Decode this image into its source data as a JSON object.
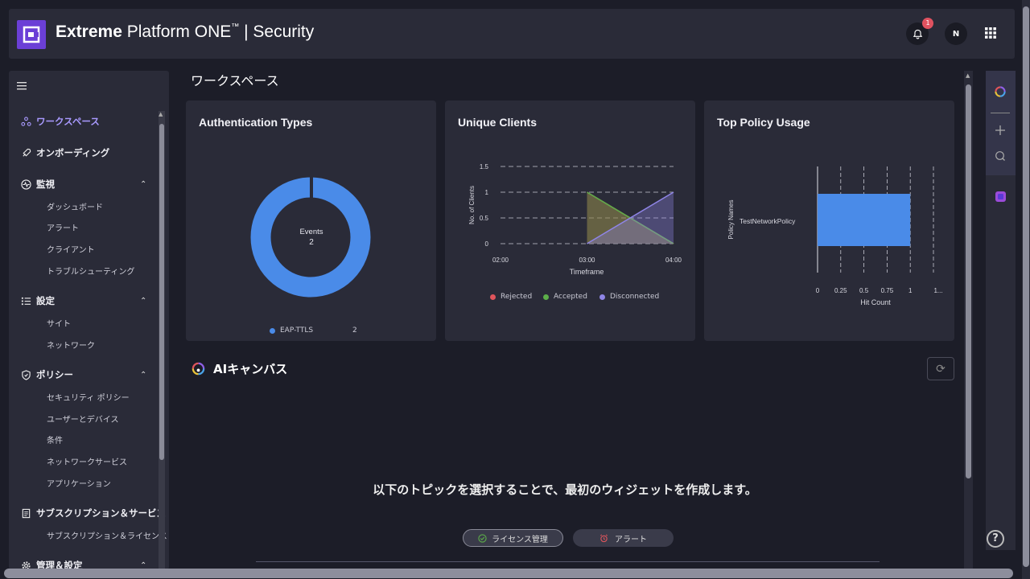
{
  "header": {
    "brand_bold": "Extreme",
    "brand_rest": " Platform ONE",
    "brand_sep": " | Security",
    "notifications_count": "1",
    "avatar_initial": "N"
  },
  "sidebar": {
    "sections": [
      {
        "label": "ワークスペース",
        "active": true,
        "items": []
      },
      {
        "label": "オンボーディング",
        "items": []
      },
      {
        "label": "監視",
        "items": [
          "ダッシュボード",
          "アラート",
          "クライアント",
          "トラブルシューティング"
        ]
      },
      {
        "label": "設定",
        "items": [
          "サイト",
          "ネットワーク"
        ]
      },
      {
        "label": "ポリシー",
        "items": [
          "セキュリティ ポリシー",
          "ユーザーとデバイス",
          "条件",
          "ネットワークサービス",
          "アプリケーション"
        ]
      },
      {
        "label": "サブスクリプション＆サービス",
        "items": [
          "サブスクリプション＆ライセンス"
        ]
      },
      {
        "label": "管理＆設定",
        "items": []
      }
    ]
  },
  "main": {
    "title": "ワークスペース",
    "ai_title": "AIキャンバス",
    "empty_message": "以下のトピックを選択することで、最初のウィジェットを作成します。",
    "pills": [
      "ライセンス管理",
      "アラート"
    ]
  },
  "colors": {
    "accent": "#6b3fd6",
    "blue": "#4a8be8",
    "rejected": "#e0555c",
    "accepted": "#5cae49",
    "disconnected": "#8f85e6"
  },
  "chart_data": [
    {
      "type": "pie",
      "title": "Authentication Types",
      "center_label": "Events",
      "center_value": "2",
      "categories": [
        "EAP-TTLS"
      ],
      "values": [
        2
      ]
    },
    {
      "type": "area",
      "title": "Unique Clients",
      "xlabel": "Timeframe",
      "ylabel": "No. of Clients",
      "x": [
        "02:00",
        "03:00",
        "04:00"
      ],
      "y_ticks": [
        "0",
        "0.5",
        "1",
        "1.5"
      ],
      "ylim": [
        0,
        1.5
      ],
      "series": [
        {
          "name": "Rejected",
          "values": [
            null,
            1,
            0
          ]
        },
        {
          "name": "Accepted",
          "values": [
            null,
            1,
            0
          ]
        },
        {
          "name": "Disconnected",
          "values": [
            null,
            0,
            1
          ]
        }
      ]
    },
    {
      "type": "bar",
      "title": "Top Policy Usage",
      "xlabel": "Hit Count",
      "ylabel": "Policy Names",
      "categories": [
        "TestNetworkPolicy"
      ],
      "values": [
        1
      ],
      "x_ticks": [
        "0",
        "0.25",
        "0.5",
        "0.75",
        "1",
        "1..."
      ],
      "xlim": [
        0,
        1.25
      ]
    }
  ]
}
